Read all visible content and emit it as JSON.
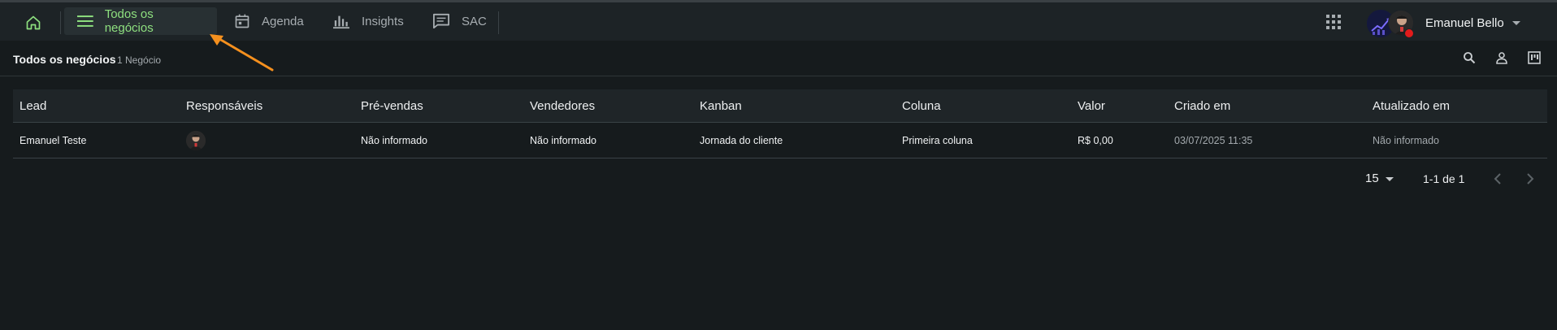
{
  "topbar": {
    "nav": [
      {
        "label": "Todos os negócios",
        "icon": "menu-icon",
        "active": true
      },
      {
        "label": "Agenda",
        "icon": "calendar-icon",
        "active": false
      },
      {
        "label": "Insights",
        "icon": "bar-chart-icon",
        "active": false
      },
      {
        "label": "SAC",
        "icon": "chat-icon",
        "active": false
      }
    ],
    "user_name": "Emanuel Bello"
  },
  "subheader": {
    "title": "Todos os negócios",
    "count": "1 Negócio"
  },
  "table": {
    "columns": [
      "Lead",
      "Responsáveis",
      "Pré-vendas",
      "Vendedores",
      "Kanban",
      "Coluna",
      "Valor",
      "Criado em",
      "Atualizado em"
    ],
    "rows": [
      {
        "lead": "Emanuel Teste",
        "pre_vendas": "Não informado",
        "vendedores": "Não informado",
        "kanban": "Jornada do cliente",
        "coluna": "Primeira coluna",
        "valor": "R$ 0,00",
        "criado_em": "03/07/2025 11:35",
        "atualizado_em": "Não informado"
      }
    ]
  },
  "pagination": {
    "page_size": "15",
    "range": "1-1 de 1"
  },
  "colors": {
    "accent": "#8ee07f",
    "background": "#161b1d",
    "topbar": "#1d2326",
    "annotation_arrow": "#f5901e",
    "status_dot": "#e21b1b"
  }
}
